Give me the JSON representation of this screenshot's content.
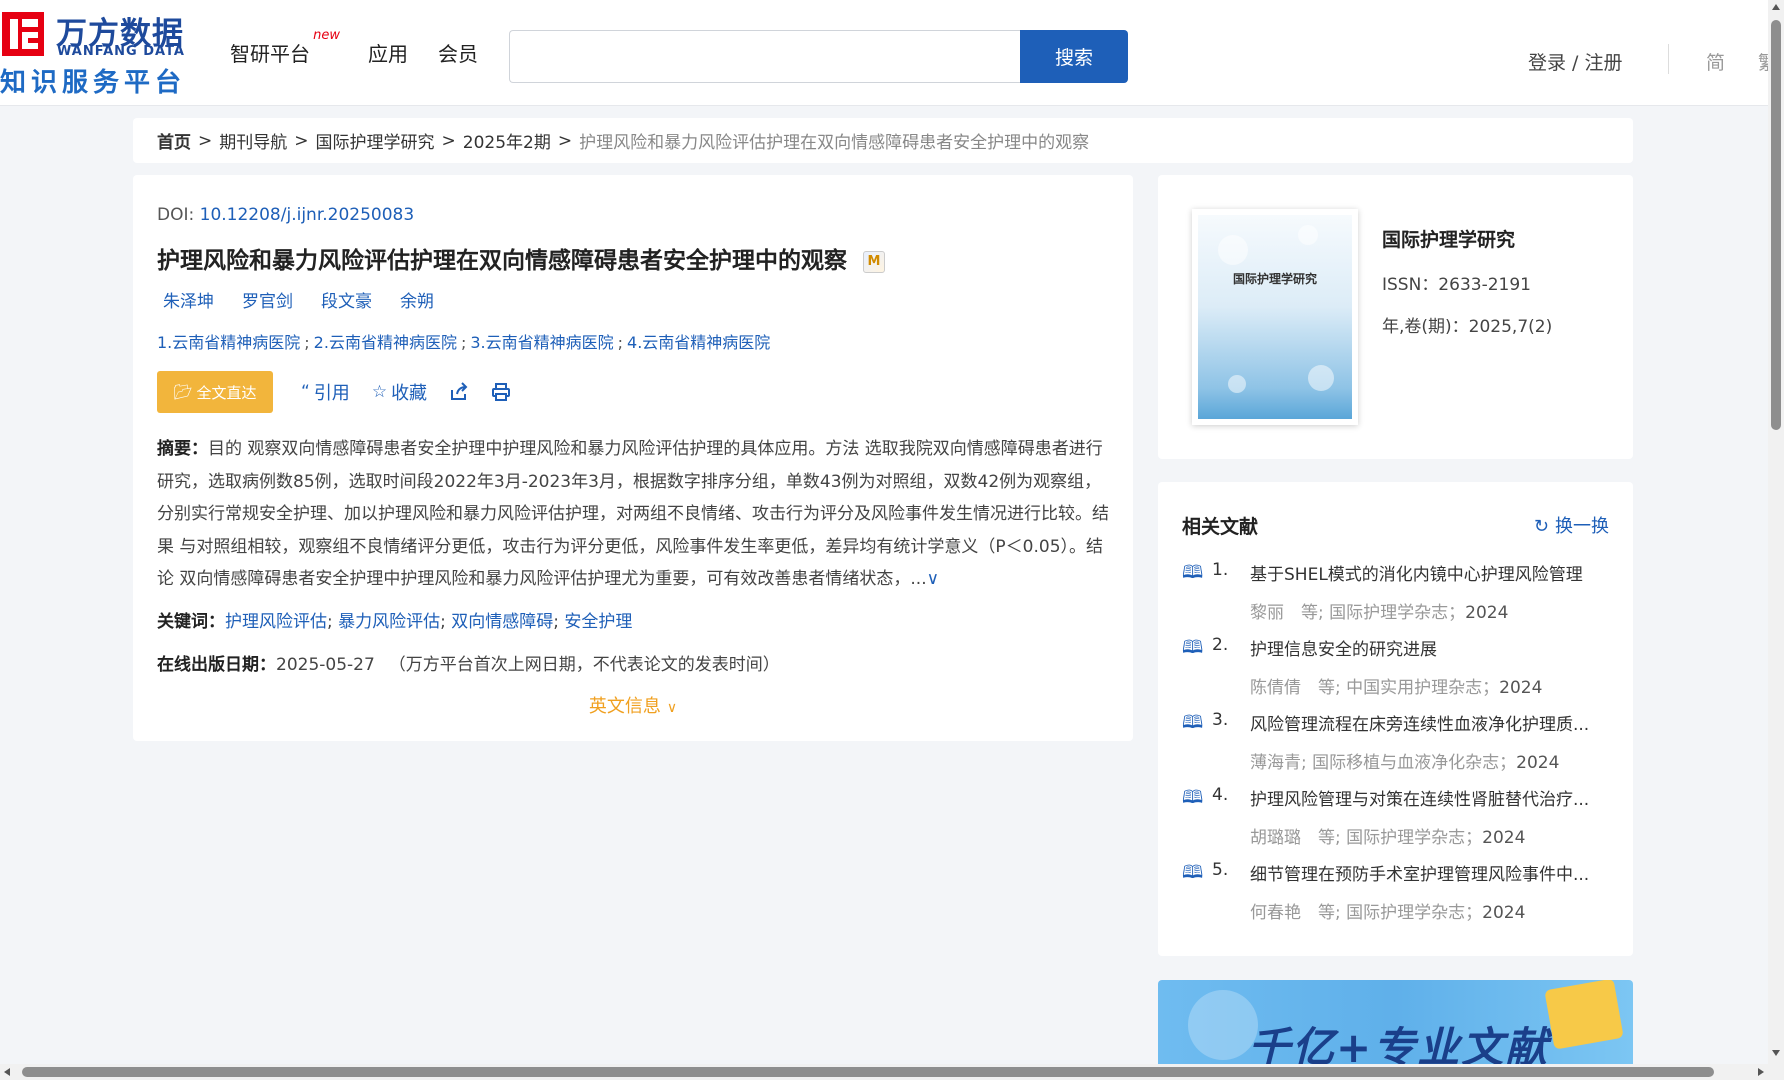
{
  "logo": {
    "cn": "万方数据",
    "en": "WANFANG DATA",
    "sub": "知识服务平台"
  },
  "nav": {
    "items": [
      "智研平台",
      "应用",
      "会员"
    ],
    "new_badge": "new"
  },
  "search": {
    "placeholder": "",
    "button": "搜索"
  },
  "user": {
    "login": "登录 / 注册",
    "lang_simplified": "简",
    "lang_traditional": "繁"
  },
  "breadcrumb": {
    "items": [
      "首页",
      "期刊导航",
      "国际护理学研究",
      "2025年2期"
    ],
    "sep": ">",
    "current": "护理风险和暴力风险评估护理在双向情感障碍患者安全护理中的观察"
  },
  "article": {
    "doi_label": "DOI: ",
    "doi": "10.12208/j.ijnr.20250083",
    "title": "护理风险和暴力风险评估护理在双向情感障碍患者安全护理中的观察",
    "m_badge": "M",
    "authors": [
      "朱泽坤",
      "罗官剑",
      "段文豪",
      "余朔"
    ],
    "affiliations": [
      "1.云南省精神病医院",
      "2.云南省精神病医院",
      "3.云南省精神病医院",
      "4.云南省精神病医院"
    ],
    "affil_sep": ";",
    "actions": {
      "fulltext": "全文直达",
      "cite": "引用",
      "favorite": "收藏"
    },
    "abstract_label": "摘要：",
    "abstract": "目的 观察双向情感障碍患者安全护理中护理风险和暴力风险评估护理的具体应用。方法 选取我院双向情感障碍患者进行研究，选取病例数85例，选取时间段2022年3月-2023年3月，根据数字排序分组，单数43例为对照组，双数42例为观察组，分别实行常规安全护理、加以护理风险和暴力风险评估护理，对两组不良情绪、攻击行为评分及风险事件发生情况进行比较。结果 与对照组相较，观察组不良情绪评分更低，攻击行为评分更低，风险事件发生率更低，差异均有统计学意义（P＜0.05）。结论 双向情感障碍患者安全护理中护理风险和暴力风险评估护理尤为重要，可有效改善患者情绪状态，",
    "abstract_more": "...",
    "keywords_label": "关键词：",
    "keywords": [
      "护理风险评估",
      "暴力风险评估",
      "双向情感障碍",
      "安全护理"
    ],
    "pubdate_label": "在线出版日期：",
    "pubdate": "2025-05-27",
    "pubdate_note": "（万方平台首次上网日期，不代表论文的发表时间）",
    "en_info": "英文信息"
  },
  "journal": {
    "cover_title": "国际护理学研究",
    "name": "国际护理学研究",
    "issn": "ISSN：2633-2191",
    "volume": "年,卷(期)：2025,7(2)"
  },
  "related": {
    "heading": "相关文献",
    "switch": "换一换",
    "items": [
      {
        "num": "1.",
        "title": "基于SHEL模式的消化内镜中心护理风险管理",
        "authors": "黎丽　等;",
        "journal": "国际护理学杂志；",
        "year": "2024"
      },
      {
        "num": "2.",
        "title": "护理信息安全的研究进展",
        "authors": "陈倩倩　等;",
        "journal": "中国实用护理杂志；",
        "year": "2024"
      },
      {
        "num": "3.",
        "title": "风险管理流程在床旁连续性血液净化护理质...",
        "authors": "薄海青;",
        "journal": "国际移植与血液净化杂志；",
        "year": "2024"
      },
      {
        "num": "4.",
        "title": "护理风险管理与对策在连续性肾脏替代治疗...",
        "authors": "胡璐璐　等;",
        "journal": "国际护理学杂志；",
        "year": "2024"
      },
      {
        "num": "5.",
        "title": "细节管理在预防手术室护理管理风险事件中...",
        "authors": "何春艳　等;",
        "journal": "国际护理学杂志；",
        "year": "2024"
      }
    ]
  },
  "banner": {
    "text": "千亿+专业文献"
  }
}
